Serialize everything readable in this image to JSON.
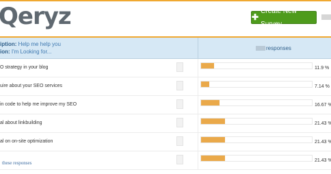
{
  "app": {
    "logo_text": "Qeryz"
  },
  "toolbar": {
    "create_survey_label": "Create New Survey",
    "create_icon": "plus-icon"
  },
  "question": {
    "description_label": "iption:",
    "description_value": "Help me help you",
    "question_label": "ion:",
    "question_value": "I'm Looking for...",
    "responses_header": "responses"
  },
  "answers": [
    {
      "label": "O strategy in your blog",
      "percent": 11.9,
      "percent_text": "11.9 %"
    },
    {
      "label": "uire about your SEO services",
      "percent": 7.14,
      "percent_text": "7.14 %"
    },
    {
      "label": "in code to help me improve my SEO",
      "percent": 16.67,
      "percent_text": "16.67 %"
    },
    {
      "label": "al about linkbuilding",
      "percent": 21.43,
      "percent_text": "21.43 %"
    },
    {
      "label": "al on on-site optimization",
      "percent": 21.43,
      "percent_text": "21.43 %"
    },
    {
      "label": "",
      "percent": 21.43,
      "percent_text": "21.43 %"
    }
  ],
  "footer": {
    "link_text": "these responses"
  },
  "colors": {
    "accent": "#f0a830",
    "button": "#4e9b1c",
    "bar": "#eaa94a",
    "header_bg": "#d6e8f5"
  }
}
